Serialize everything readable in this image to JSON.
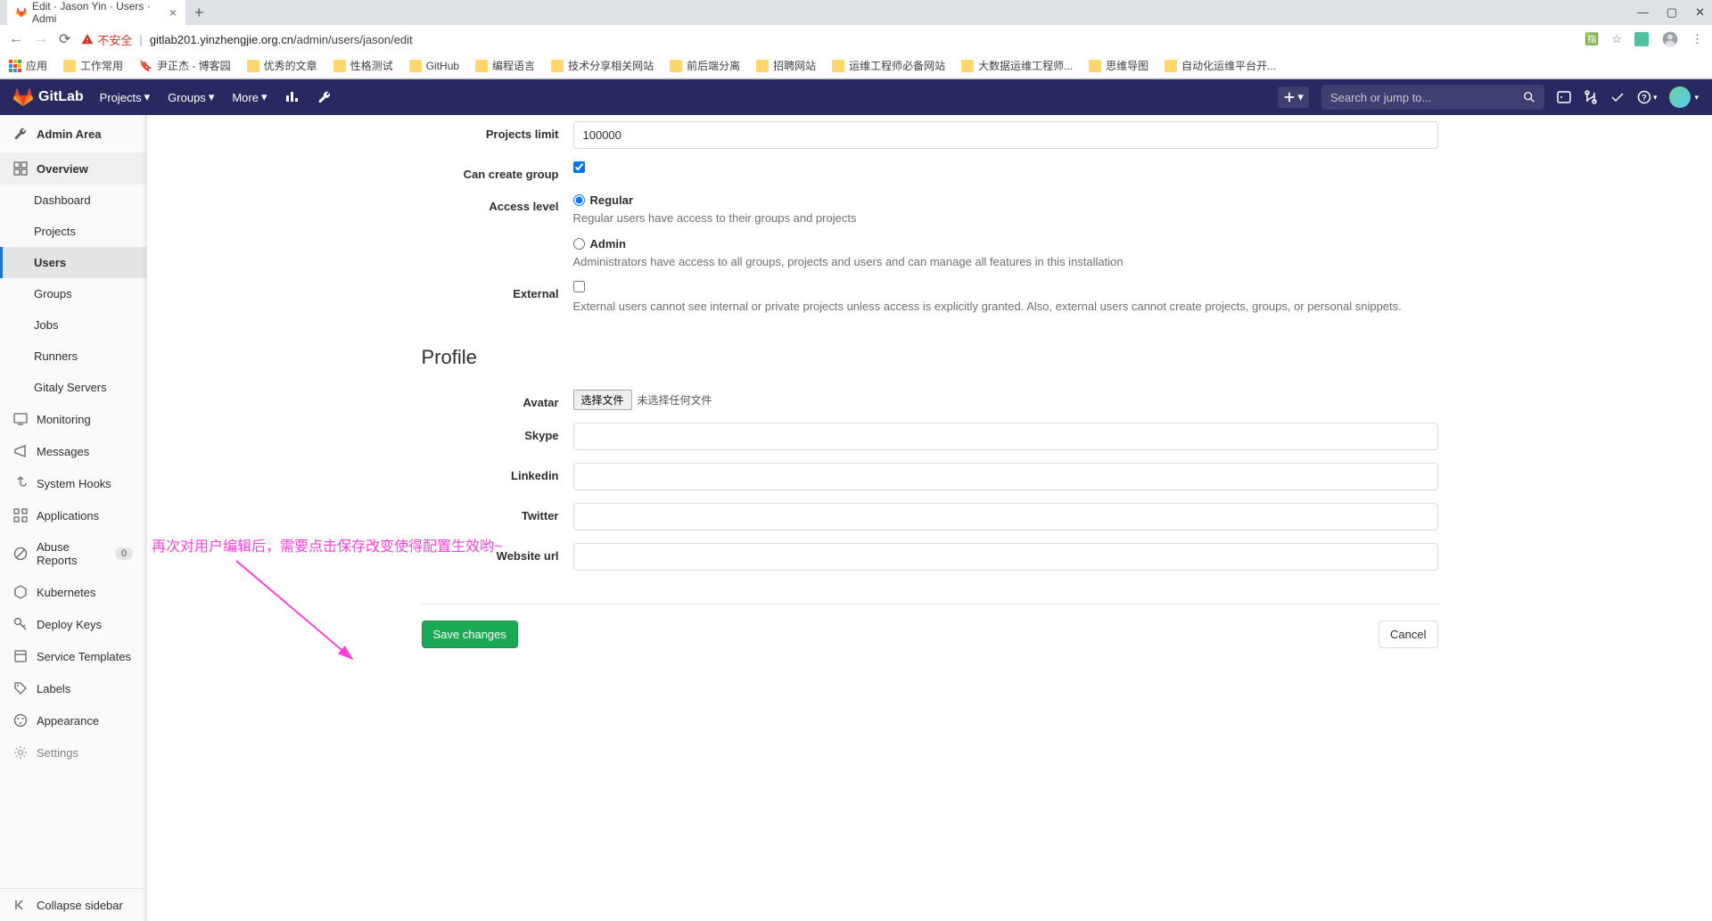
{
  "browser": {
    "tab_title": "Edit · Jason Yin · Users · Admi",
    "insecure_label": "不安全",
    "url_host": "gitlab201.yinzhengjie.org.cn",
    "url_path": "/admin/users/jason/edit",
    "bookmarks": {
      "apps": "应用",
      "items": [
        "工作常用",
        "尹正杰 - 博客园",
        "优秀的文章",
        "性格测试",
        "GitHub",
        "编程语言",
        "技术分享相关网站",
        "前后端分离",
        "招聘网站",
        "运维工程师必备网站",
        "大数据运维工程师...",
        "思维导图",
        "自动化运维平台开..."
      ]
    }
  },
  "gitlab": {
    "brand": "GitLab",
    "menu": {
      "projects": "Projects",
      "groups": "Groups",
      "more": "More"
    },
    "search_placeholder": "Search or jump to..."
  },
  "sidebar": {
    "title": "Admin Area",
    "overview": "Overview",
    "sub": {
      "dashboard": "Dashboard",
      "projects": "Projects",
      "users": "Users",
      "groups": "Groups",
      "jobs": "Jobs",
      "runners": "Runners",
      "gitaly": "Gitaly Servers"
    },
    "monitoring": "Monitoring",
    "messages": "Messages",
    "hooks": "System Hooks",
    "applications": "Applications",
    "abuse": "Abuse Reports",
    "abuse_count": "0",
    "kubernetes": "Kubernetes",
    "deploy_keys": "Deploy Keys",
    "service_templates": "Service Templates",
    "labels": "Labels",
    "appearance": "Appearance",
    "settings": "Settings",
    "collapse": "Collapse sidebar"
  },
  "form": {
    "projects_limit_label": "Projects limit",
    "projects_limit_value": "100000",
    "can_create_group_label": "Can create group",
    "access_level_label": "Access level",
    "regular_label": "Regular",
    "regular_help": "Regular users have access to their groups and projects",
    "admin_label": "Admin",
    "admin_help": "Administrators have access to all groups, projects and users and can manage all features in this installation",
    "external_label": "External",
    "external_help": "External users cannot see internal or private projects unless access is explicitly granted. Also, external users cannot create projects, groups, or personal snippets.",
    "profile_section": "Profile",
    "avatar_label": "Avatar",
    "file_button": "选择文件",
    "file_status": "未选择任何文件",
    "skype_label": "Skype",
    "linkedin_label": "Linkedin",
    "twitter_label": "Twitter",
    "website_label": "Website url",
    "save": "Save changes",
    "cancel": "Cancel"
  },
  "annotation": "再次对用户编辑后，需要点击保存改变使得配置生效哟~"
}
